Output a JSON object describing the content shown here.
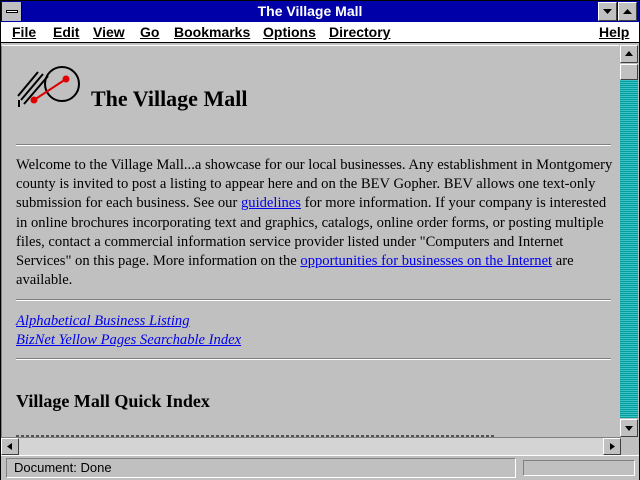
{
  "window": {
    "title": "The Village Mall"
  },
  "menu": {
    "file": "File",
    "edit": "Edit",
    "view": "View",
    "go": "Go",
    "bookmarks": "Bookmarks",
    "options": "Options",
    "directory": "Directory",
    "help": "Help"
  },
  "page": {
    "title": "The Village Mall",
    "intro": {
      "p1": "Welcome to the Village Mall...a showcase for our local businesses. Any establishment in Montgomery county is invited to post a listing to appear here and on the BEV Gopher. BEV allows one text-only submission for each business. See our ",
      "link1": "guidelines",
      "p2": " for more information. If your company is interested in online brochures incorporating text and graphics, catalogs, online order forms, or posting multiple files, contact a commercial information service provider listed under \"Computers and Internet Services\" on this page. More information on the ",
      "link2": "opportunities for businesses on the Internet",
      "p3": " are available."
    },
    "links": [
      "Alphabetical Business Listing",
      "BizNet Yellow Pages Searchable Index"
    ],
    "quick_index_heading": "Village Mall Quick Index"
  },
  "status": {
    "text": "Document: Done"
  },
  "colors": {
    "titlebar": "#0000a8",
    "link": "#0000ee",
    "scroll_track": "#40c0c0"
  }
}
